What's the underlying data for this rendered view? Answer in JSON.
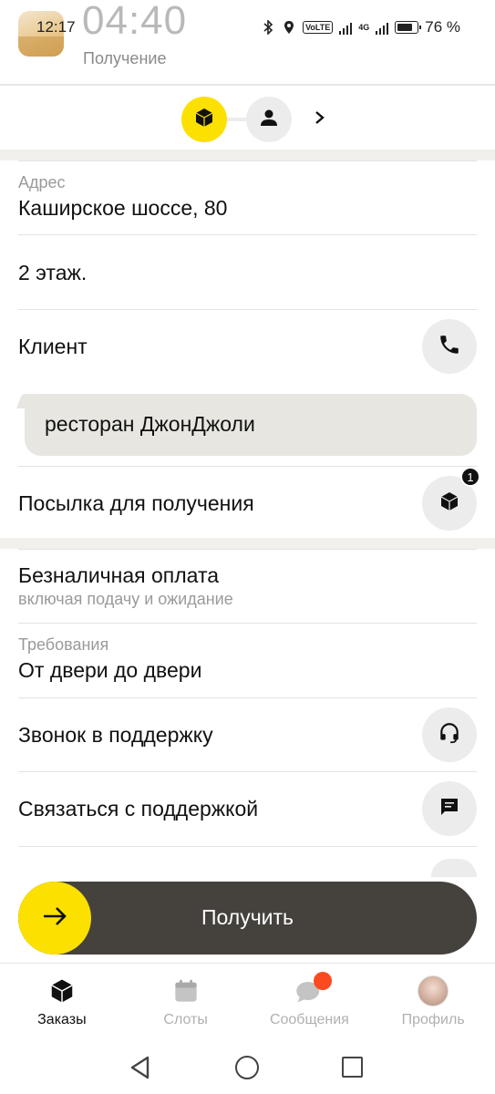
{
  "status_bar": {
    "time": "12:17",
    "clock_overlay": "04:40",
    "subtitle": "Получение",
    "volte": "VoLTE",
    "network": "4G",
    "battery": "76 %"
  },
  "stepper": {
    "steps": [
      {
        "icon": "cargo-box-icon",
        "active": true
      },
      {
        "icon": "person-icon",
        "active": false
      }
    ],
    "next_icon": "chevron-right-icon"
  },
  "address": {
    "label": "Адрес",
    "value": "Каширское шоссе, 80"
  },
  "floor": "2 этаж.",
  "client": {
    "label": "Клиент",
    "comment": "ресторан ДжонДжоли"
  },
  "parcel": {
    "label": "Посылка для получения",
    "count": "1"
  },
  "payment": {
    "title": "Безналичная оплата",
    "subtitle": "включая подачу и ожидание"
  },
  "requirements": {
    "label": "Требования",
    "value": "От двери до двери"
  },
  "support_call": "Звонок в поддержку",
  "support_chat": "Связаться с поддержкой",
  "action": {
    "label": "Получить"
  },
  "bottom_nav": {
    "items": [
      {
        "label": "Заказы",
        "icon": "orders-icon",
        "active": true
      },
      {
        "label": "Слоты",
        "icon": "calendar-icon",
        "active": false
      },
      {
        "label": "Сообщения",
        "icon": "messages-icon",
        "active": false
      },
      {
        "label": "Профиль",
        "icon": "avatar",
        "active": false
      }
    ]
  },
  "colors": {
    "accent": "#fce000",
    "action_bar": "#45423e",
    "notification_dot": "#fb4a1f"
  }
}
